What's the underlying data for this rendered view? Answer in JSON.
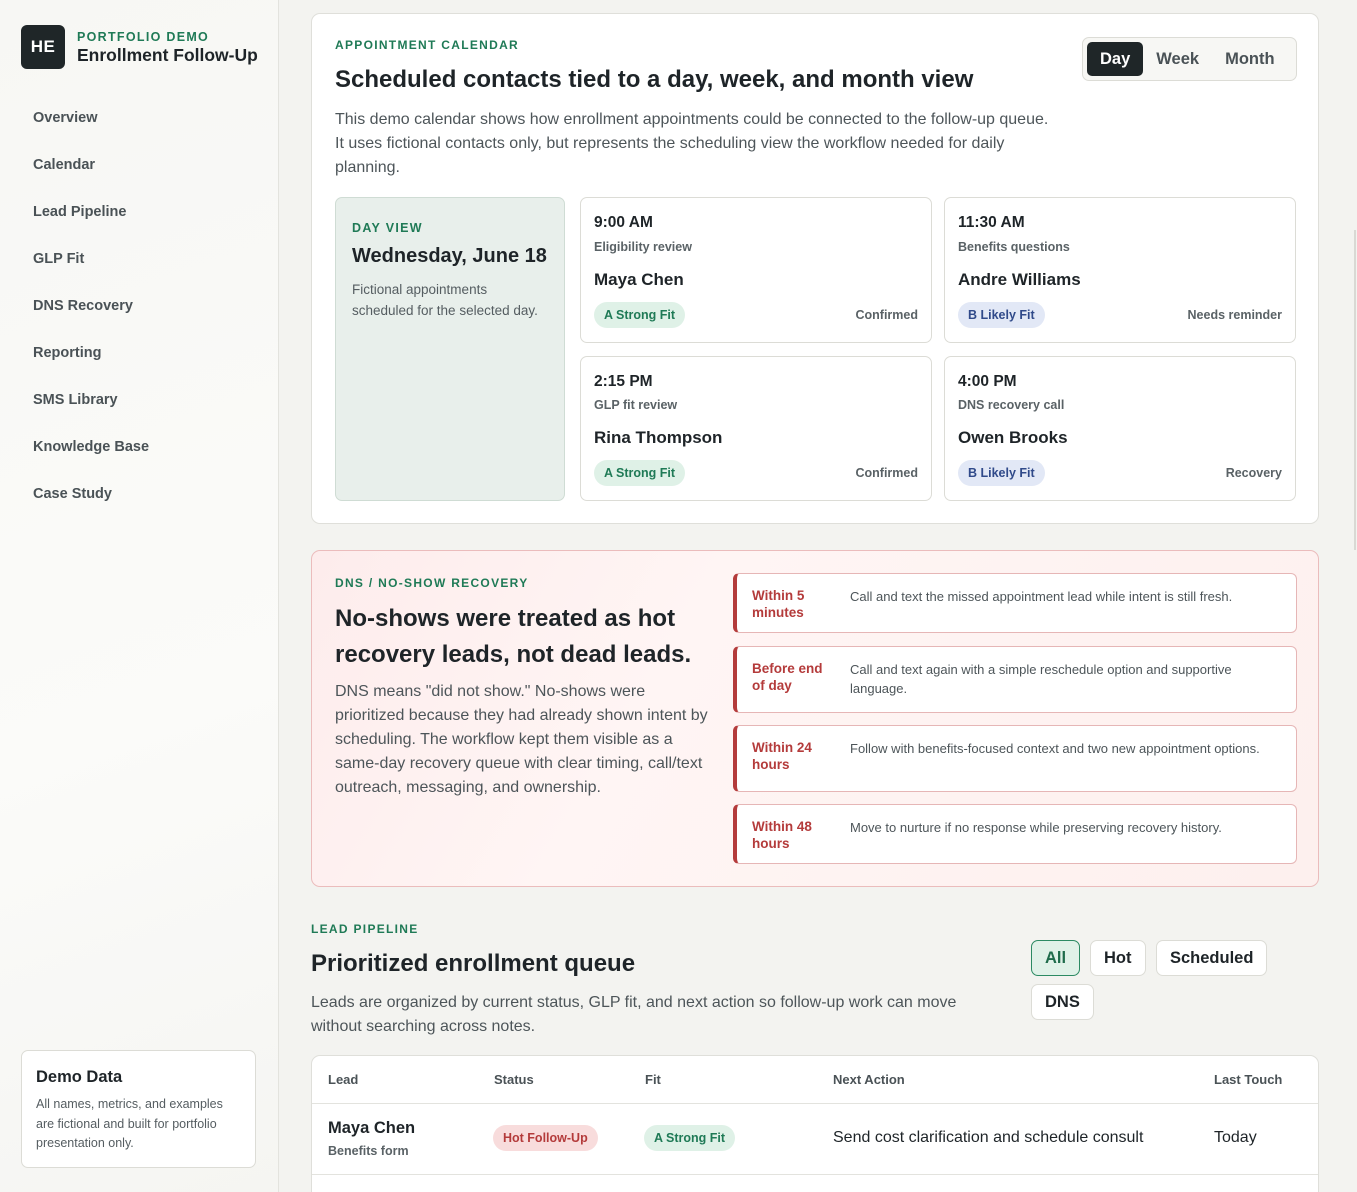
{
  "sidebar": {
    "logo": "HE",
    "eyebrow": "PORTFOLIO DEMO",
    "title": "Enrollment Follow-Up",
    "nav": [
      "Overview",
      "Calendar",
      "Lead Pipeline",
      "GLP Fit",
      "DNS Recovery",
      "Reporting",
      "SMS Library",
      "Knowledge Base",
      "Case Study"
    ],
    "demo_card": {
      "title": "Demo Data",
      "text": "All names, metrics, and examples are fictional and built for portfolio presentation only."
    }
  },
  "calendar": {
    "eyebrow": "APPOINTMENT CALENDAR",
    "title": "Scheduled contacts tied to a day, week, and month view",
    "description": "This demo calendar shows how enrollment appointments could be connected to the follow-up queue. It uses fictional contacts only, but represents the scheduling view the workflow needed for daily planning.",
    "views": [
      "Day",
      "Week",
      "Month"
    ],
    "active_view": "Day",
    "day_panel": {
      "eyebrow": "DAY VIEW",
      "date": "Wednesday, June 18",
      "text": "Fictional appointments scheduled for the selected day."
    },
    "appointments": [
      {
        "time": "9:00 AM",
        "type": "Eligibility review",
        "name": "Maya Chen",
        "fit": "A Strong Fit",
        "fit_kind": "a",
        "status": "Confirmed"
      },
      {
        "time": "11:30 AM",
        "type": "Benefits questions",
        "name": "Andre Williams",
        "fit": "B Likely Fit",
        "fit_kind": "b",
        "status": "Needs reminder"
      },
      {
        "time": "2:15 PM",
        "type": "GLP fit review",
        "name": "Rina Thompson",
        "fit": "A Strong Fit",
        "fit_kind": "a",
        "status": "Confirmed"
      },
      {
        "time": "4:00 PM",
        "type": "DNS recovery call",
        "name": "Owen Brooks",
        "fit": "B Likely Fit",
        "fit_kind": "b",
        "status": "Recovery"
      }
    ]
  },
  "dns": {
    "eyebrow": "DNS / NO-SHOW RECOVERY",
    "title": "No-shows were treated as hot recovery leads, not dead leads.",
    "description": "DNS means \"did not show.\" No-shows were prioritized because they had already shown intent by scheduling. The workflow kept them visible as a same-day recovery queue with clear timing, call/text outreach, messaging, and ownership.",
    "steps": [
      {
        "when": "Within 5 minutes",
        "text": "Call and text the missed appointment lead while intent is still fresh."
      },
      {
        "when": "Before end of day",
        "text": "Call and text again with a simple reschedule option and supportive language."
      },
      {
        "when": "Within 24 hours",
        "text": "Follow with benefits-focused context and two new appointment options."
      },
      {
        "when": "Within 48 hours",
        "text": "Move to nurture if no response while preserving recovery history."
      }
    ]
  },
  "pipeline": {
    "eyebrow": "LEAD PIPELINE",
    "title": "Prioritized enrollment queue",
    "description": "Leads are organized by current status, GLP fit, and next action so follow-up work can move without searching across notes.",
    "filters": [
      "All",
      "Hot",
      "Scheduled",
      "DNS"
    ],
    "active_filter": "All",
    "columns": [
      "Lead",
      "Status",
      "Fit",
      "Next Action",
      "Last Touch"
    ],
    "rows": [
      {
        "name": "Maya Chen",
        "source": "Benefits form",
        "status": "Hot Follow-Up",
        "fit": "A Strong Fit",
        "next_action": "Send cost clarification and schedule consult",
        "last_touch": "Today"
      }
    ]
  },
  "colors": {
    "accent_green": "#1f7a56",
    "dark": "#1f2628",
    "alert_red": "#b43b3b",
    "fit_b_blue": "#304a8a"
  }
}
